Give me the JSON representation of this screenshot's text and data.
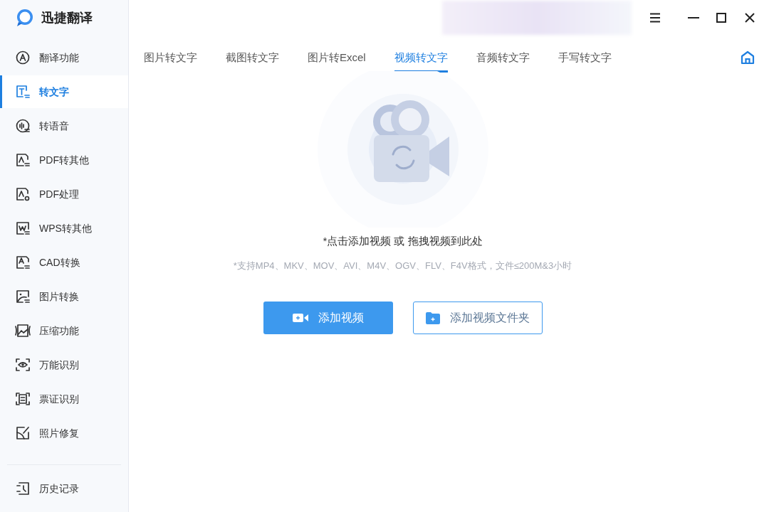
{
  "app": {
    "title": "迅捷翻译"
  },
  "sidebar": {
    "items": [
      {
        "label": "翻译功能",
        "selected": false
      },
      {
        "label": "转文字",
        "selected": true
      },
      {
        "label": "转语音",
        "selected": false
      },
      {
        "label": "PDF转其他",
        "selected": false
      },
      {
        "label": "PDF处理",
        "selected": false
      },
      {
        "label": "WPS转其他",
        "selected": false
      },
      {
        "label": "CAD转换",
        "selected": false
      },
      {
        "label": "图片转换",
        "selected": false
      },
      {
        "label": "压缩功能",
        "selected": false
      },
      {
        "label": "万能识别",
        "selected": false
      },
      {
        "label": "票证识别",
        "selected": false
      },
      {
        "label": "照片修复",
        "selected": false
      }
    ],
    "footer_item": {
      "label": "历史记录"
    }
  },
  "tabs": [
    {
      "label": "图片转文字",
      "selected": false
    },
    {
      "label": "截图转文字",
      "selected": false
    },
    {
      "label": "图片转Excel",
      "selected": false
    },
    {
      "label": "视频转文字",
      "selected": true
    },
    {
      "label": "音频转文字",
      "selected": false
    },
    {
      "label": "手写转文字",
      "selected": false
    }
  ],
  "drop_area": {
    "hint": "*点击添加视频 或 拖拽视频到此处",
    "formats": "*支持MP4、MKV、MOV、AVI、M4V、OGV、FLV、F4V格式，文件≤200M&3小时"
  },
  "buttons": [
    {
      "kind": "primary",
      "label": "添加视频"
    },
    {
      "kind": "outline",
      "label": "添加视频文件夹"
    }
  ]
}
